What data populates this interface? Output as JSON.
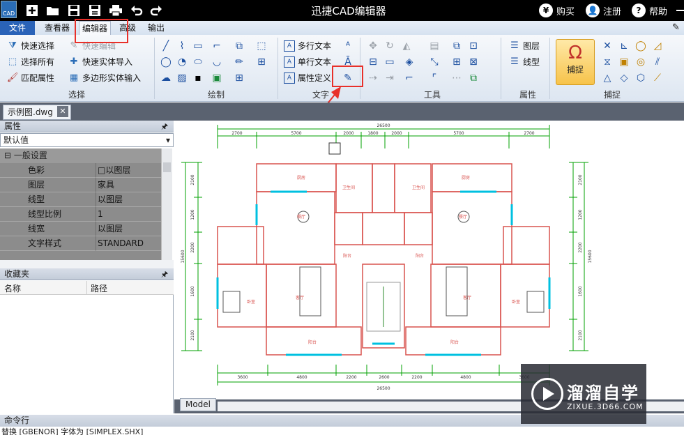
{
  "app": {
    "icon_text": "CAD",
    "title": "迅捷CAD编辑器"
  },
  "title_links": {
    "buy": "购买",
    "buy_glyph": "¥",
    "register": "注册",
    "help": "帮助",
    "help_glyph": "?"
  },
  "menu": {
    "file": "文件",
    "tabs": [
      "查看器",
      "编辑器",
      "高级",
      "输出"
    ]
  },
  "ribbon": {
    "select": {
      "label": "选择",
      "quick_select": "快速选择",
      "quick_edit": "快速编辑",
      "select_all": "选择所有",
      "quick_entity_import": "快速实体导入",
      "match_props": "匹配属性",
      "polygon_entity_input": "多边形实体输入"
    },
    "draw": {
      "label": "绘制"
    },
    "text": {
      "label": "文字",
      "mtext": "多行文本",
      "stext": "单行文本",
      "attdef": "属性定义"
    },
    "tools": {
      "label": "工具"
    },
    "props": {
      "label": "属性",
      "layer": "图层",
      "linetype": "线型"
    },
    "snap": {
      "label": "捕捉",
      "snap_button": "捕捉"
    }
  },
  "document": {
    "tab": "示例图.dwg",
    "close": "✕",
    "model_tab": "Model"
  },
  "properties_panel": {
    "title": "属性",
    "pin": "ᵖ",
    "combo": "默认值",
    "section": "一般设置",
    "rows": [
      {
        "name": "色彩",
        "value": "□以图层"
      },
      {
        "name": "图层",
        "value": "家具"
      },
      {
        "name": "线型",
        "value": "以图层"
      },
      {
        "name": "线型比例",
        "value": "1"
      },
      {
        "name": "线宽",
        "value": "以图层"
      },
      {
        "name": "文字样式",
        "value": "STANDARD"
      }
    ]
  },
  "favorites_panel": {
    "title": "收藏夹",
    "col_name": "名称",
    "col_path": "路径"
  },
  "command": {
    "title": "命令行",
    "text": "替换 [GBENOR] 字体为 [SIMPLEX.SHX]"
  },
  "drawing": {
    "rooms": [
      "厨房",
      "厨房",
      "卫生间",
      "卫生间",
      "餐厅",
      "餐厅",
      "客厅",
      "客厅",
      "卧室",
      "卧室",
      "阳台",
      "阳台",
      "阳台",
      "阳台"
    ],
    "top_dims": [
      "2700",
      "5700",
      "2000",
      "1800",
      "2000",
      "5700",
      "2700"
    ],
    "top_total": "26500",
    "bottom_dims": [
      "3600",
      "4800",
      "2200",
      "2600",
      "2200",
      "4800",
      "3600"
    ],
    "bottom_total": "26500",
    "left_dims": [
      "2100",
      "1200",
      "2200",
      "1600",
      "2100"
    ],
    "right_dims": [
      "2100",
      "1200",
      "2200",
      "1600",
      "2100"
    ],
    "side_total": "15600"
  },
  "watermark": {
    "title": "溜溜自学",
    "url": "ZIXUE.3D66.COM"
  },
  "colors": {
    "accent": "#2a63b8",
    "highlight": "#e8302a",
    "drawing_wall": "#d9534f",
    "drawing_dim": "#00a000",
    "drawing_cyan": "#00c0e0"
  }
}
